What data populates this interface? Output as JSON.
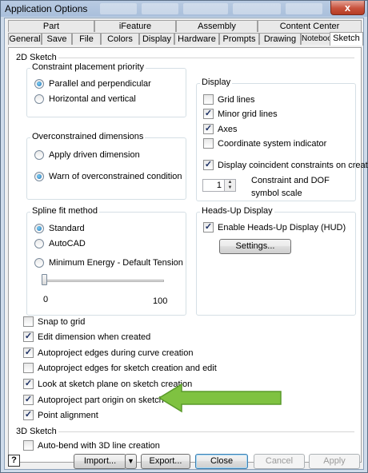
{
  "window": {
    "title": "Application Options",
    "close_glyph": "x"
  },
  "tabs": {
    "row1": [
      "Part",
      "iFeature",
      "Assembly",
      "Content Center"
    ],
    "row2": [
      "General",
      "Save",
      "File",
      "Colors",
      "Display",
      "Hardware",
      "Prompts",
      "Drawing",
      "Notebook",
      "Sketch"
    ],
    "active": "Sketch"
  },
  "sketch2d": {
    "heading": "2D Sketch",
    "constraint_placement": {
      "title": "Constraint placement priority",
      "options": [
        "Parallel and perpendicular",
        "Horizontal and vertical"
      ],
      "selected": "Parallel and perpendicular"
    },
    "overconstrained": {
      "title": "Overconstrained dimensions",
      "options": [
        "Apply driven dimension",
        "Warn of overconstrained condition"
      ],
      "selected": "Warn of overconstrained condition"
    },
    "spline_fit": {
      "title": "Spline fit method",
      "options": [
        "Standard",
        "AutoCAD",
        "Minimum Energy - Default Tension"
      ],
      "selected": "Standard",
      "slider_min": "0",
      "slider_max": "100",
      "slider_value": 0
    },
    "display": {
      "title": "Display",
      "items": [
        {
          "label": "Grid lines",
          "checked": false
        },
        {
          "label": "Minor grid lines",
          "checked": true
        },
        {
          "label": "Axes",
          "checked": true
        },
        {
          "label": "Coordinate system indicator",
          "checked": false
        },
        {
          "label": "Display coincident constraints on creation",
          "checked": true
        }
      ],
      "scale_value": "1",
      "scale_label_1": "Constraint and DOF",
      "scale_label_2": "symbol scale"
    },
    "hud": {
      "title": "Heads-Up Display",
      "enable_label": "Enable Heads-Up Display (HUD)",
      "enable_checked": true,
      "settings_label": "Settings..."
    },
    "options": [
      {
        "label": "Snap to grid",
        "checked": false
      },
      {
        "label": "Edit dimension when created",
        "checked": true
      },
      {
        "label": "Autoproject edges during curve creation",
        "checked": true
      },
      {
        "label": "Autoproject edges for sketch creation and edit",
        "checked": false
      },
      {
        "label": "Look at sketch plane on sketch creation",
        "checked": true
      },
      {
        "label": "Autoproject part origin on sketch create",
        "checked": true
      },
      {
        "label": "Point alignment",
        "checked": true
      }
    ]
  },
  "sketch3d": {
    "heading": "3D Sketch",
    "auto_bend_label": "Auto-bend with 3D line creation",
    "auto_bend_checked": false
  },
  "footer": {
    "help_glyph": "?",
    "import_label": "Import...",
    "export_label": "Export...",
    "close_label": "Close",
    "cancel_label": "Cancel",
    "apply_label": "Apply"
  },
  "colors": {
    "arrow_fill": "#7fc241",
    "arrow_stroke": "#5a9a2a"
  }
}
